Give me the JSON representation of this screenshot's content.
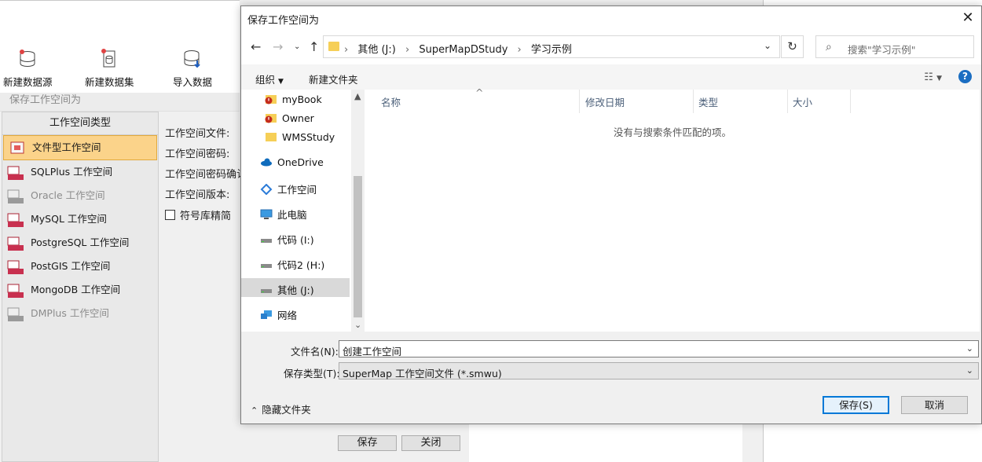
{
  "ribbon": {
    "new_datasource": "新建数据源",
    "new_dataset": "新建数据集",
    "import_data": "导入数据"
  },
  "panel": {
    "title": "保存工作空间为",
    "type_header": "工作空间类型",
    "types": [
      {
        "label": "文件型工作空间",
        "selected": true,
        "enabled": true
      },
      {
        "label": "SQLPlus 工作空间",
        "enabled": true
      },
      {
        "label": "Oracle 工作空间",
        "enabled": false
      },
      {
        "label": "MySQL 工作空间",
        "enabled": true
      },
      {
        "label": "PostgreSQL 工作空间",
        "enabled": true
      },
      {
        "label": "PostGIS 工作空间",
        "enabled": true
      },
      {
        "label": "MongoDB 工作空间",
        "enabled": true
      },
      {
        "label": "DMPlus 工作空间",
        "enabled": false
      }
    ],
    "fields": {
      "file": "工作空间文件:",
      "password": "工作空间密码:",
      "password_confirm": "工作空间密码确认",
      "version": "工作空间版本:",
      "symbol_compact": "符号库精简"
    },
    "save": "保存",
    "close": "关闭"
  },
  "dialog": {
    "title": "保存工作空间为",
    "breadcrumbs": [
      "其他 (J:)",
      "SuperMapDStudy",
      "学习示例"
    ],
    "search_placeholder": "搜索\"学习示例\"",
    "organize": "组织",
    "new_folder": "新建文件夹",
    "help": "?",
    "nav_items": [
      {
        "label": "myBook",
        "icon": "warning-folder-icon"
      },
      {
        "label": "Owner",
        "icon": "warning-folder-icon"
      },
      {
        "label": "WMSStudy",
        "icon": "folder-icon"
      },
      {
        "label": "OneDrive",
        "icon": "cloud-icon"
      },
      {
        "label": "工作空间",
        "icon": "workspace-icon"
      },
      {
        "label": "此电脑",
        "icon": "computer-icon"
      },
      {
        "label": "代码 (I:)",
        "icon": "drive-icon"
      },
      {
        "label": "代码2 (H:)",
        "icon": "drive-icon"
      },
      {
        "label": "其他 (J:)",
        "icon": "drive-icon",
        "selected": true
      },
      {
        "label": "网络",
        "icon": "network-icon"
      }
    ],
    "columns": {
      "name": "名称",
      "modified": "修改日期",
      "type": "类型",
      "size": "大小"
    },
    "empty_message": "没有与搜索条件匹配的项。",
    "filename_label": "文件名(N):",
    "filename_value": "创建工作空间",
    "filetype_label": "保存类型(T):",
    "filetype_value": "SuperMap 工作空间文件 (*.smwu)",
    "hide_folders": "隐藏文件夹",
    "save": "保存(S)",
    "cancel": "取消"
  }
}
